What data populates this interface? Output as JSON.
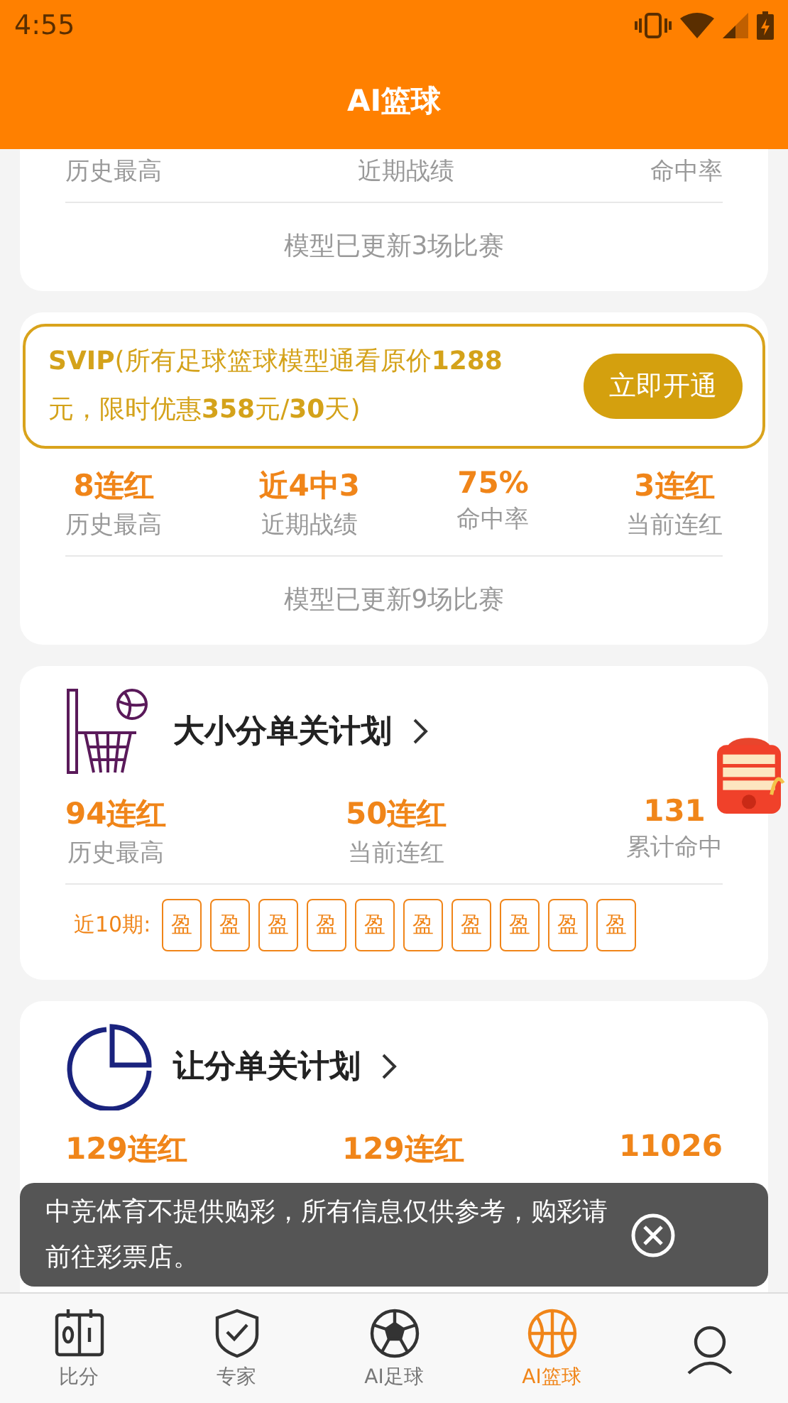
{
  "status_bar": {
    "time": "4:55"
  },
  "header": {
    "title": "AI篮球"
  },
  "cards": [
    {
      "kind": "summary",
      "stats": [
        {
          "label": "历史最高"
        },
        {
          "label": "近期战绩"
        },
        {
          "label": "命中率"
        }
      ],
      "footer": "模型已更新3场比赛"
    },
    {
      "kind": "summary",
      "promo": {
        "text": "**SVIP**(所有足球篮球模型通看原价**1288**元，限时优惠**358**元/**30**天)",
        "button": "立即开通"
      },
      "stats": [
        {
          "value": "8连红",
          "label": "历史最高"
        },
        {
          "value": "近4中3",
          "label": "近期战绩"
        },
        {
          "value": "75%",
          "label": "命中率"
        },
        {
          "value": "3连红",
          "label": "当前连红"
        }
      ],
      "footer": "模型已更新9场比赛"
    },
    {
      "kind": "plan",
      "title": "大小分单关计划",
      "stats": [
        {
          "value": "94连红",
          "label": "历史最高"
        },
        {
          "value": "50连红",
          "label": "当前连红"
        },
        {
          "value": "131",
          "label": "累计命中"
        }
      ],
      "recent": {
        "label": "近10期:",
        "results": [
          "盈",
          "盈",
          "盈",
          "盈",
          "盈",
          "盈",
          "盈",
          "盈",
          "盈",
          "盈"
        ]
      }
    },
    {
      "kind": "plan",
      "title": "让分单关计划",
      "stats": [
        {
          "value": "129连红"
        },
        {
          "value": "129连红"
        },
        {
          "value": "11026"
        }
      ]
    }
  ],
  "toast": {
    "text": "中竞体育不提供购彩，所有信息仅供参考，购彩请前往彩票店。"
  },
  "tabs": [
    {
      "label": "比分",
      "selected": false
    },
    {
      "label": "专家",
      "selected": false
    },
    {
      "label": "AI足球",
      "selected": false
    },
    {
      "label": "AI篮球",
      "selected": true
    },
    {
      "selected": false
    }
  ]
}
